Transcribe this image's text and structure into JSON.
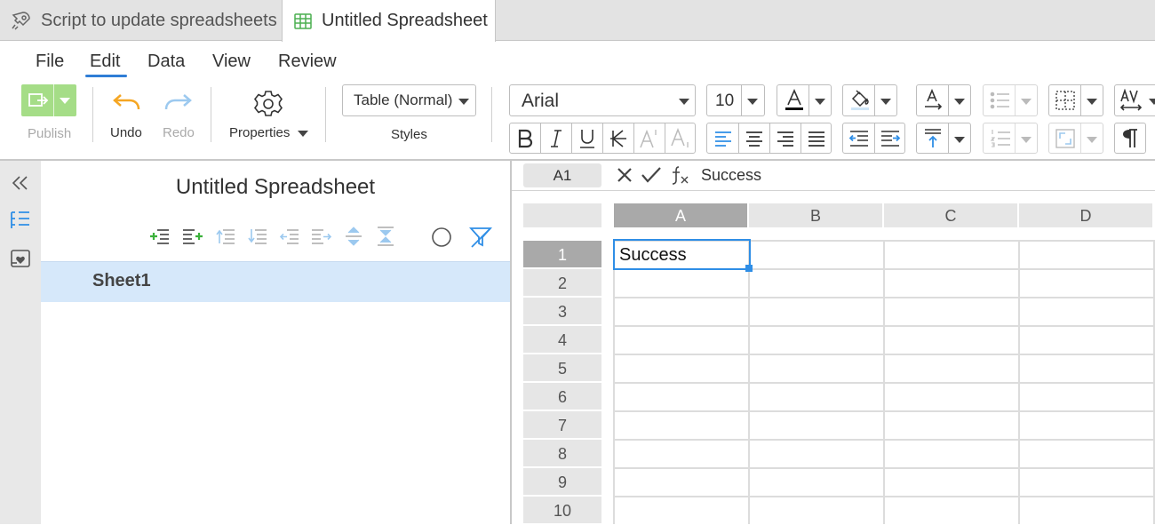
{
  "tabs": [
    {
      "label": "Script to update spreadsheets",
      "icon": "rocket-icon",
      "active": false
    },
    {
      "label": "Untitled Spreadsheet",
      "icon": "spreadsheet-icon",
      "active": true
    }
  ],
  "menu": [
    "File",
    "Edit",
    "Data",
    "View",
    "Review"
  ],
  "menu_active": "Edit",
  "ribbon": {
    "publish": "Publish",
    "undo": "Undo",
    "redo": "Redo",
    "properties": "Properties",
    "style_value": "Table (Normal)",
    "styles_label": "Styles",
    "font_name": "Arial",
    "font_size": "10"
  },
  "panel": {
    "title": "Untitled Spreadsheet",
    "sheets": [
      "Sheet1"
    ]
  },
  "formula_bar": {
    "cell_ref": "A1",
    "value": "Success"
  },
  "grid": {
    "columns": [
      "A",
      "B",
      "C",
      "D"
    ],
    "rows": [
      "1",
      "2",
      "3",
      "4",
      "5",
      "6",
      "7",
      "8",
      "9",
      "10"
    ],
    "selected_cell": "A1",
    "cells": {
      "A1": "Success"
    }
  },
  "colors": {
    "accent": "#2f8ee6",
    "publish_green": "#a5dd87",
    "undo_orange": "#f5a623",
    "selected_row": "#d6e8fa"
  }
}
